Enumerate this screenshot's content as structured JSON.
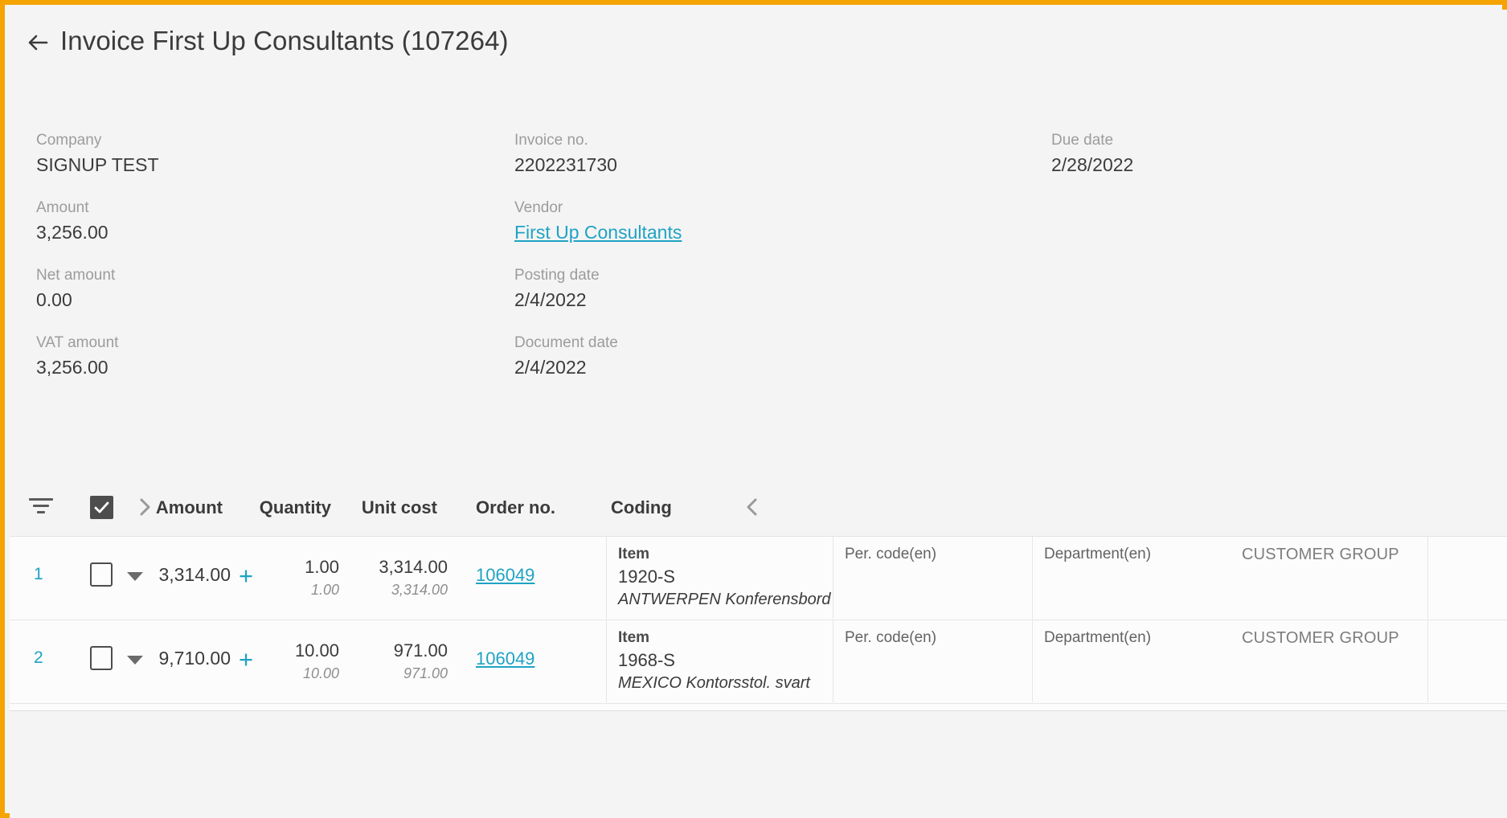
{
  "window": {
    "accent_border_color": "#f5a300",
    "link_color": "#1fa3c4",
    "background_color": "#f4f4f4"
  },
  "header": {
    "back_icon": "arrow-left-icon",
    "title": "Invoice First Up Consultants (107264)"
  },
  "meta": {
    "column_left": [
      {
        "label": "Company",
        "value": "SIGNUP TEST",
        "is_link": false
      },
      {
        "label": "Amount",
        "value": "3,256.00",
        "is_link": false
      },
      {
        "label": "Net amount",
        "value": "0.00",
        "is_link": false
      },
      {
        "label": "VAT amount",
        "value": "3,256.00",
        "is_link": false
      }
    ],
    "column_middle": [
      {
        "label": "Invoice no.",
        "value": "2202231730",
        "is_link": false
      },
      {
        "label": "Vendor",
        "value": "First Up Consultants",
        "is_link": true
      },
      {
        "label": "Posting date",
        "value": "2/4/2022",
        "is_link": false
      },
      {
        "label": "Document date",
        "value": "2/4/2022",
        "is_link": false
      }
    ],
    "column_right": [
      {
        "label": "Due date",
        "value": "2/28/2022",
        "is_link": false
      }
    ]
  },
  "table": {
    "toolbar": {
      "filter_icon": "filter-lines-icon",
      "select_all_checkbox": {
        "icon": "checkbox-checked-icon",
        "checked": true
      },
      "expand_right_icon": "chevron-right-icon",
      "collapse_left_icon": "chevron-left-icon"
    },
    "columns": [
      {
        "key": "amount",
        "label": "Amount"
      },
      {
        "key": "quantity",
        "label": "Quantity"
      },
      {
        "key": "unit_cost",
        "label": "Unit cost"
      },
      {
        "key": "order_no",
        "label": "Order no."
      },
      {
        "key": "coding",
        "label": "Coding"
      }
    ],
    "rows": [
      {
        "line_no": "1",
        "checkbox": {
          "icon": "checkbox-unchecked-icon",
          "checked": false
        },
        "expand_icon": "caret-down-icon",
        "amount": "3,314.00",
        "add_icon": "plus-icon",
        "quantity": "1.00",
        "quantity_sub": "1.00",
        "unit_cost": "3,314.00",
        "unit_cost_sub": "3,314.00",
        "order_no": "106049",
        "coding": {
          "dimension_label": "Item",
          "code": "1920-S",
          "description": "ANTWERPEN Konferensbord"
        },
        "per_code": "Per. code(en)",
        "department": "Department(en)",
        "customer_group": "CUSTOMER GROUP"
      },
      {
        "line_no": "2",
        "checkbox": {
          "icon": "checkbox-unchecked-icon",
          "checked": false
        },
        "expand_icon": "caret-down-icon",
        "amount": "9,710.00",
        "add_icon": "plus-icon",
        "quantity": "10.00",
        "quantity_sub": "10.00",
        "unit_cost": "971.00",
        "unit_cost_sub": "971.00",
        "order_no": "106049",
        "coding": {
          "dimension_label": "Item",
          "code": "1968-S",
          "description": "MEXICO Kontorsstol. svart"
        },
        "per_code": "Per. code(en)",
        "department": "Department(en)",
        "customer_group": "CUSTOMER GROUP"
      }
    ]
  }
}
